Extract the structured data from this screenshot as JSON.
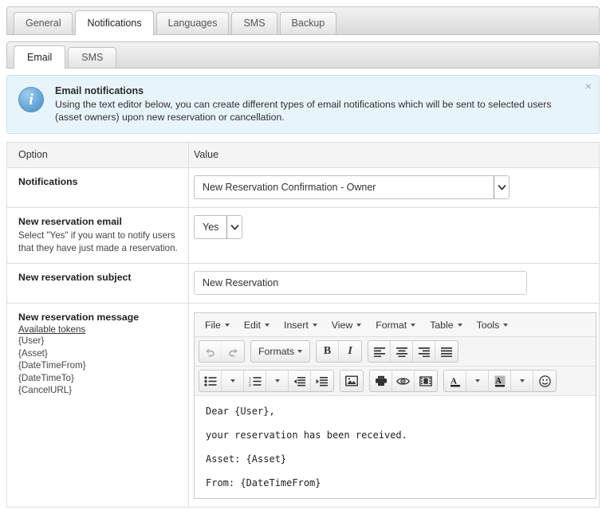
{
  "primary_tabs": [
    {
      "label": "General",
      "active": false
    },
    {
      "label": "Notifications",
      "active": true
    },
    {
      "label": "Languages",
      "active": false
    },
    {
      "label": "SMS",
      "active": false
    },
    {
      "label": "Backup",
      "active": false
    }
  ],
  "secondary_tabs": [
    {
      "label": "Email",
      "active": true
    },
    {
      "label": "SMS",
      "active": false
    }
  ],
  "alert": {
    "icon": "info-icon",
    "title": "Email notifications",
    "text": "Using the text editor below, you can create different types of email notifications which will be sent to selected users (asset owners) upon new reservation or cancellation.",
    "close_label": "×",
    "background": "#e8f4fb",
    "border": "#c5e2f2",
    "icon_color": "#6aa9d8"
  },
  "table": {
    "headers": {
      "option": "Option",
      "value": "Value"
    },
    "rows": [
      {
        "label": "Notifications",
        "help": "",
        "control": "select",
        "value": "New Reservation Confirmation - Owner"
      },
      {
        "label": "New reservation email",
        "help": "Select \"Yes\" if you want to notify users that they have just made a reservation.",
        "control": "select-small",
        "value": "Yes"
      },
      {
        "label": "New reservation subject",
        "help": "",
        "control": "text",
        "value": "New Reservation",
        "placeholder": ""
      },
      {
        "label": "New reservation message",
        "tokens_link": "Available tokens",
        "tokens": [
          "{User}",
          "{Asset}",
          "{DateTimeFrom}",
          "{DateTimeTo}",
          "{CancelURL}"
        ],
        "control": "editor"
      }
    ]
  },
  "editor": {
    "menus": [
      "File",
      "Edit",
      "Insert",
      "View",
      "Format",
      "Table",
      "Tools"
    ],
    "toolbar_row1": [
      {
        "name": "undo",
        "glyph": "↶",
        "disabled": true
      },
      {
        "name": "redo",
        "glyph": "↷",
        "disabled": true
      },
      {
        "name": "formats",
        "label": "Formats",
        "caret": true
      },
      {
        "name": "bold",
        "glyph": "B"
      },
      {
        "name": "italic",
        "glyph": "I"
      },
      {
        "name": "align-left"
      },
      {
        "name": "align-center"
      },
      {
        "name": "align-right"
      },
      {
        "name": "align-justify"
      }
    ],
    "toolbar_row2": [
      {
        "name": "bullet-list",
        "caret": true
      },
      {
        "name": "numbered-list",
        "caret": true
      },
      {
        "name": "outdent"
      },
      {
        "name": "indent"
      },
      {
        "name": "insert-image"
      },
      {
        "name": "print"
      },
      {
        "name": "preview"
      },
      {
        "name": "insert-media"
      },
      {
        "name": "text-color",
        "caret": true
      },
      {
        "name": "background-color",
        "caret": true
      },
      {
        "name": "emoticon"
      }
    ],
    "content": [
      {
        "text": "Dear {User},"
      },
      {
        "text": ""
      },
      {
        "text": "your reservation has been received."
      },
      {
        "text": "Asset: {Asset}"
      },
      {
        "text": "From: {DateTimeFrom}"
      }
    ]
  }
}
